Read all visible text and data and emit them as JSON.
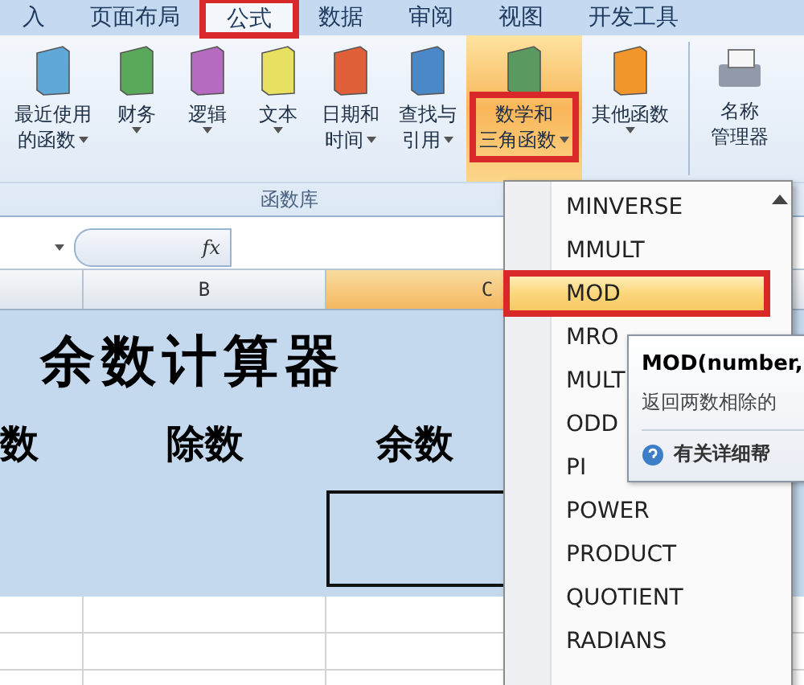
{
  "tabs": [
    {
      "label": "入",
      "selected": false,
      "highlighted": false
    },
    {
      "label": "页面布局",
      "selected": false,
      "highlighted": false
    },
    {
      "label": "公式",
      "selected": true,
      "highlighted": true
    },
    {
      "label": "数据",
      "selected": false,
      "highlighted": false
    },
    {
      "label": "审阅",
      "selected": false,
      "highlighted": false
    },
    {
      "label": "视图",
      "selected": false,
      "highlighted": false
    },
    {
      "label": "开发工具",
      "selected": false,
      "highlighted": false
    }
  ],
  "ribbon": {
    "group_label": "函数库",
    "buttons": [
      {
        "kind": "book",
        "color": "#5fa8d8",
        "line1": "最近使用",
        "line2": "的函数",
        "dropdown": true,
        "active": false,
        "highlighted": false
      },
      {
        "kind": "book",
        "color": "#5aa85a",
        "line1": "财务",
        "dropdown": true,
        "active": false,
        "highlighted": false
      },
      {
        "kind": "book",
        "color": "#b56cc0",
        "line1": "逻辑",
        "dropdown": true,
        "active": false,
        "highlighted": false
      },
      {
        "kind": "book",
        "color": "#e8e060",
        "line1": "文本",
        "dropdown": true,
        "active": false,
        "highlighted": false
      },
      {
        "kind": "book",
        "color": "#e0603a",
        "line1": "日期和",
        "line2": "时间",
        "dropdown": true,
        "active": false,
        "highlighted": false
      },
      {
        "kind": "book",
        "color": "#4a88c8",
        "line1": "查找与",
        "line2": "引用",
        "dropdown": true,
        "active": false,
        "highlighted": false
      },
      {
        "kind": "book",
        "color": "#5a9a60",
        "line1": "数学和",
        "line2": "三角函数",
        "dropdown": true,
        "active": true,
        "highlighted": true
      },
      {
        "kind": "book",
        "color": "#f0962a",
        "line1": "其他函数",
        "dropdown": true,
        "active": false,
        "highlighted": false
      },
      {
        "kind": "cards",
        "color": "#909aa8",
        "line1": "名称",
        "line2": "管理器",
        "dropdown": false,
        "active": false,
        "highlighted": false
      }
    ]
  },
  "formula_bar": {
    "fx": "fx"
  },
  "columns": [
    {
      "selected": false
    },
    {
      "label": "B",
      "selected": false
    },
    {
      "label": "C",
      "selected": true
    }
  ],
  "sheet": {
    "title": "余数计算器",
    "headers": [
      "数",
      "除数",
      "余数"
    ]
  },
  "menu": {
    "items": [
      {
        "label": "MINVERSE",
        "selected": false,
        "highlighted": false
      },
      {
        "label": "MMULT",
        "selected": false,
        "highlighted": false
      },
      {
        "label": "MOD",
        "selected": true,
        "highlighted": true
      },
      {
        "label": "MRO",
        "selected": false,
        "highlighted": false
      },
      {
        "label": "MULT",
        "selected": false,
        "highlighted": false
      },
      {
        "label": "ODD",
        "selected": false,
        "highlighted": false
      },
      {
        "label": "PI",
        "selected": false,
        "highlighted": false
      },
      {
        "label": "POWER",
        "selected": false,
        "highlighted": false
      },
      {
        "label": "PRODUCT",
        "selected": false,
        "highlighted": false
      },
      {
        "label": "QUOTIENT",
        "selected": false,
        "highlighted": false
      },
      {
        "label": "RADIANS",
        "selected": false,
        "highlighted": false
      }
    ]
  },
  "tooltip": {
    "title": "MOD(number,",
    "description": "返回两数相除的",
    "help": "有关详细帮"
  }
}
